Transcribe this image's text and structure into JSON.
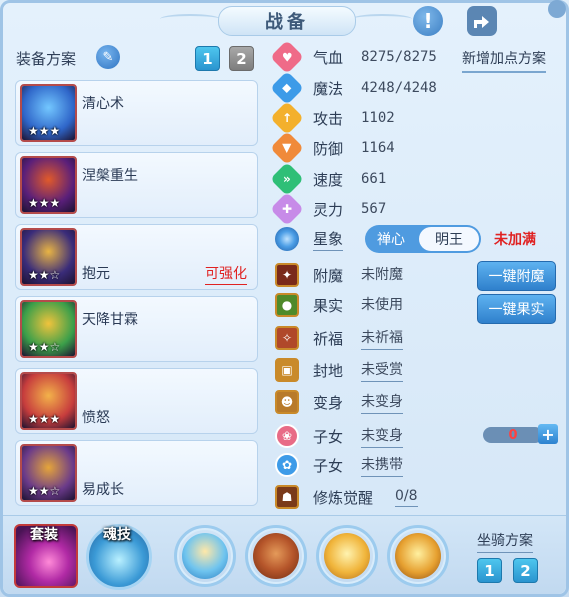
{
  "header": {
    "title": "战备"
  },
  "equip_plan": {
    "label": "装备方案",
    "buttons": [
      "1",
      "2"
    ]
  },
  "equipment": [
    {
      "name": "清心术",
      "stars": "★★★",
      "tag": "",
      "colors": [
        "#2f66c9",
        "#73c7ff"
      ]
    },
    {
      "name": "涅槃重生",
      "stars": "★★★",
      "tag": "",
      "colors": [
        "#5a1f7a",
        "#e15a2a"
      ]
    },
    {
      "name": "抱元",
      "stars": "★★☆",
      "tag": "可强化",
      "colors": [
        "#3a2c7a",
        "#e8b444"
      ]
    },
    {
      "name": "天降甘霖",
      "stars": "★★☆",
      "tag": "",
      "colors": [
        "#3b9f4a",
        "#f0c33c"
      ]
    },
    {
      "name": "愤怒",
      "stars": "★★★",
      "tag": "",
      "colors": [
        "#c73d3d",
        "#f3b24a"
      ]
    },
    {
      "name": "易成长",
      "stars": "★★☆",
      "tag": "",
      "colors": [
        "#6a3a8a",
        "#e5a53a"
      ]
    }
  ],
  "add_plan_label": "新增加点方案",
  "stats": [
    {
      "name": "气血",
      "value": "8275/8275",
      "icon": "heart-icon",
      "color": "#ef6b88",
      "glyph": "♥"
    },
    {
      "name": "魔法",
      "value": "4248/4248",
      "icon": "mana-icon",
      "color": "#3d9be8",
      "glyph": "◆"
    },
    {
      "name": "攻击",
      "value": "1102",
      "icon": "attack-icon",
      "color": "#f3b02c",
      "glyph": "↑"
    },
    {
      "name": "防御",
      "value": "1164",
      "icon": "defense-icon",
      "color": "#f08a3a",
      "glyph": "▼"
    },
    {
      "name": "速度",
      "value": "661",
      "icon": "speed-icon",
      "color": "#2fbf77",
      "glyph": "»"
    },
    {
      "name": "灵力",
      "value": "567",
      "icon": "spirit-icon",
      "color": "#c78be8",
      "glyph": "✚"
    }
  ],
  "star_sign": {
    "label": "星象",
    "options": [
      "禅心",
      "明王"
    ],
    "status": "未加满"
  },
  "actions": [
    {
      "name": "附魔",
      "value": "未附魔",
      "underline": false,
      "bg": "#7a2a1a",
      "glyph": "✦"
    },
    {
      "name": "果实",
      "value": "未使用",
      "underline": false,
      "bg": "#4f8a2a",
      "glyph": "●"
    },
    {
      "name": "祈福",
      "value": "未祈福",
      "underline": true,
      "bg": "#b0482a",
      "glyph": "✧"
    },
    {
      "name": "封地",
      "value": "未受赏",
      "underline": true,
      "bg": "#c98a2a",
      "glyph": "▣"
    },
    {
      "name": "变身",
      "value": "未变身",
      "underline": true,
      "bg": "#b87a2a",
      "glyph": "☻"
    }
  ],
  "buttons": {
    "enchant": "一键附魔",
    "fruit": "一键果实"
  },
  "children": [
    {
      "name": "子女",
      "value": "未变身",
      "color": "#e86b86",
      "glyph": "❀"
    },
    {
      "name": "子女",
      "value": "未携带",
      "color": "#3d9be8",
      "glyph": "✿"
    }
  ],
  "child_count": "0",
  "cultivation": {
    "name": "修炼觉醒",
    "value": "0/8"
  },
  "bottom": {
    "suit_label": "套装",
    "soul_label": "魂技",
    "mount_label": "坐骑方案",
    "mount_buttons": [
      "1",
      "2"
    ]
  }
}
